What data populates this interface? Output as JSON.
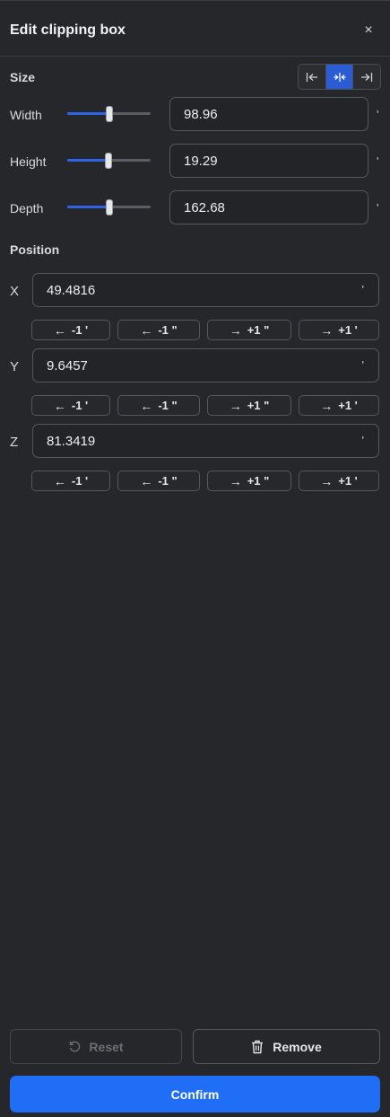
{
  "header": {
    "title": "Edit clipping box",
    "close_symbol": "×"
  },
  "size": {
    "label": "Size",
    "alignment": {
      "options": [
        "align-left-icon",
        "align-center-icon",
        "align-right-icon"
      ],
      "selected": "align-center-icon"
    },
    "rows": [
      {
        "label": "Width",
        "value": "98.96",
        "unit": "'",
        "slider_fraction": 0.5
      },
      {
        "label": "Height",
        "value": "19.29",
        "unit": "'",
        "slider_fraction": 0.5
      },
      {
        "label": "Depth",
        "value": "162.68",
        "unit": "'",
        "slider_fraction": 0.5
      }
    ]
  },
  "position": {
    "label": "Position",
    "axes": [
      {
        "label": "X",
        "value": "49.4816",
        "unit": "'"
      },
      {
        "label": "Y",
        "value": "9.6457",
        "unit": "'"
      },
      {
        "label": "Z",
        "value": "81.3419",
        "unit": "'"
      }
    ],
    "steps": [
      {
        "arrow": "←",
        "label": "-1 '"
      },
      {
        "arrow": "←",
        "label": "-1 \""
      },
      {
        "arrow": "→",
        "label": "+1 \""
      },
      {
        "arrow": "→",
        "label": "+1 '"
      }
    ]
  },
  "footer": {
    "reset_label": "Reset",
    "remove_label": "Remove",
    "confirm_label": "Confirm"
  },
  "colors": {
    "accent": "#2f62e8",
    "confirm": "#1f6ef5",
    "background": "#25272b"
  }
}
